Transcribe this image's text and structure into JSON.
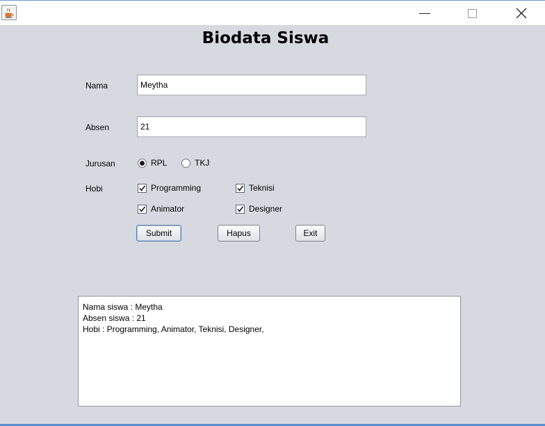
{
  "window": {
    "icon": "java-coffee-icon",
    "controls": [
      "minimize-icon",
      "maximize-icon",
      "close-icon"
    ]
  },
  "form": {
    "title": "Biodata Siswa",
    "nama": {
      "label": "Nama",
      "value": "Meytha"
    },
    "absen": {
      "label": "Absen",
      "value": "21"
    },
    "jurusan": {
      "label": "Jurusan",
      "options": [
        {
          "label": "RPL",
          "selected": true
        },
        {
          "label": "TKJ",
          "selected": false
        }
      ]
    },
    "hobi": {
      "label": "Hobi",
      "options": [
        {
          "label": "Programming",
          "checked": true
        },
        {
          "label": "Teknisi",
          "checked": true
        },
        {
          "label": "Animator",
          "checked": true
        },
        {
          "label": "Designer",
          "checked": true
        }
      ]
    },
    "buttons": {
      "submit": "Submit",
      "hapus": "Hapus",
      "exit": "Exit"
    }
  },
  "output": {
    "lines": [
      "Nama siswa : Meytha",
      "Absen siswa : 21",
      "Hobi : Programming, Animator, Teknisi, Designer,"
    ]
  }
}
